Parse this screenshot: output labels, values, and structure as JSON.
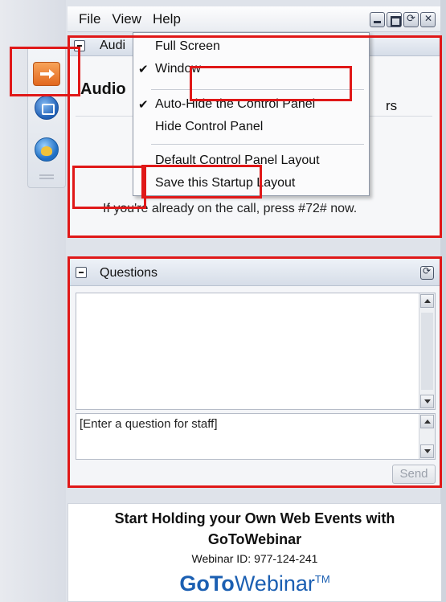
{
  "menubar": {
    "items": [
      "File",
      "View",
      "Help"
    ]
  },
  "view_menu": {
    "items": [
      {
        "label": "Full Screen",
        "checked": false
      },
      {
        "label": "Window",
        "checked": true
      },
      {
        "label": "Auto-Hide the Control Panel",
        "checked": true
      },
      {
        "label": "Hide Control Panel",
        "checked": false
      },
      {
        "label": "Default Control Panel Layout",
        "checked": false
      },
      {
        "label": "Save this Startup Layout",
        "checked": false
      }
    ]
  },
  "audio": {
    "header_title": "Audi",
    "big_title": "Audio",
    "partial_text": "rs",
    "note": "If you're already on the call, press #72# now."
  },
  "questions": {
    "header_title": "Questions",
    "input_placeholder": "[Enter a question for staff]",
    "send_label": "Send"
  },
  "promo": {
    "line1": "Start Holding your Own Web Events with",
    "line2": "GoToWebinar",
    "webinar_id": "Webinar ID: 977-124-241",
    "logo_bold": "GoTo",
    "logo_light": "Webinar",
    "logo_tm": "TM"
  },
  "colors": {
    "highlight_red": "#e01818",
    "brand_blue": "#1b5fb2",
    "accent_orange": "#e2681f"
  }
}
